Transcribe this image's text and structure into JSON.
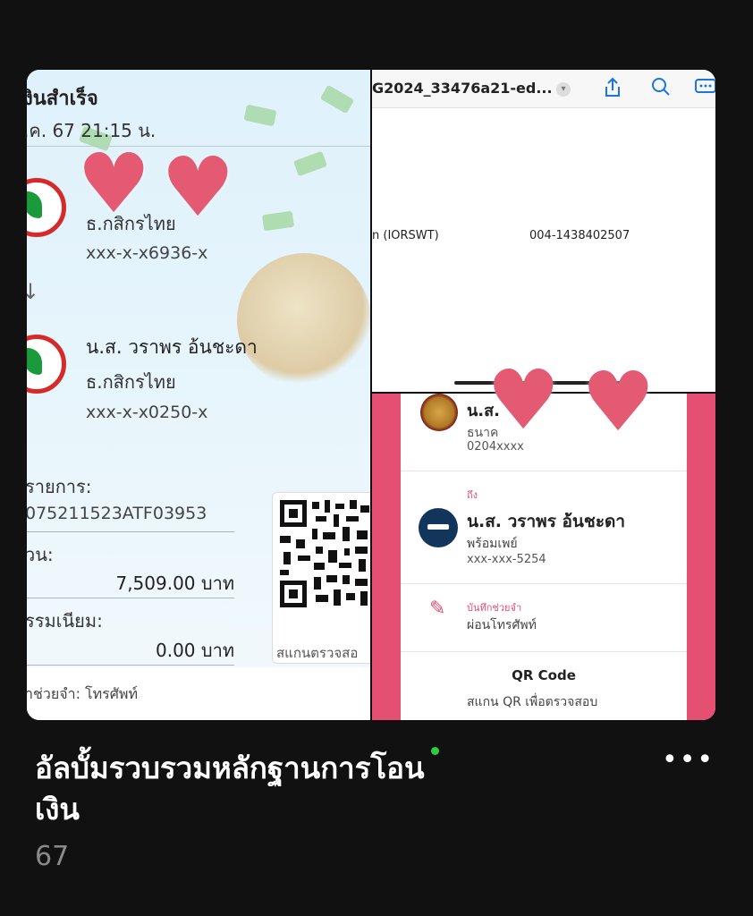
{
  "album": {
    "title": "อัลบั้มรวบรวมหลักฐานการโอนเงิน",
    "count": "67",
    "more_icon": "more-horizontal-icon",
    "status_color": "#2ecc40"
  },
  "slip_left": {
    "title": "งินสำเร็จ",
    "datetime": ".ค. 67  21:15 น.",
    "sender_bank": "ธ.กสิกรไทย",
    "sender_account": "xxx-x-x6936-x",
    "arrow": "↓",
    "receiver_name": "น.ส. วราพร อ้นชะดา",
    "receiver_bank": "ธ.กสิกรไทย",
    "receiver_account": "xxx-x-x0250-x",
    "ref_label": "รายการ:",
    "ref_value": "075211523ATF03953",
    "amount_label": "วน:",
    "amount_value": "7,509.00 บาท",
    "fee_label": "รรมเนียม:",
    "fee_value": "0.00 บาท",
    "qr_caption": "สแกนตรวจสอ",
    "memo": "าช่วยจำ: โทรศัพท์"
  },
  "pdf_viewer": {
    "file_name": "G2024_33476a21-ed...",
    "line_left": "n (IORSWT)",
    "line_right": "004-1438402507",
    "icons": [
      "share-icon",
      "search-icon",
      "more-icon"
    ]
  },
  "slip_right": {
    "sender_name": "น.ส.",
    "sender_bank": "ธนาค",
    "sender_account": "0204xxxx",
    "to_label": "ถึง",
    "receiver_name": "น.ส. วราพร อ้นชะดา",
    "receiver_channel": "พร้อมเพย์",
    "receiver_account": "xxx-xxx-5254",
    "memo_label": "บันทึกช่วยจำ",
    "memo_value": "ผ่อนโทรศัพท์",
    "qr_title": "QR Code",
    "qr_desc": "สแกน QR เพื่อตรวจสอบ"
  },
  "colors": {
    "background": "#111111",
    "kbank_green": "#1a9a3a",
    "kbank_red": "#d62a2a",
    "pink": "#e54f72",
    "heart": "#e35a72"
  }
}
